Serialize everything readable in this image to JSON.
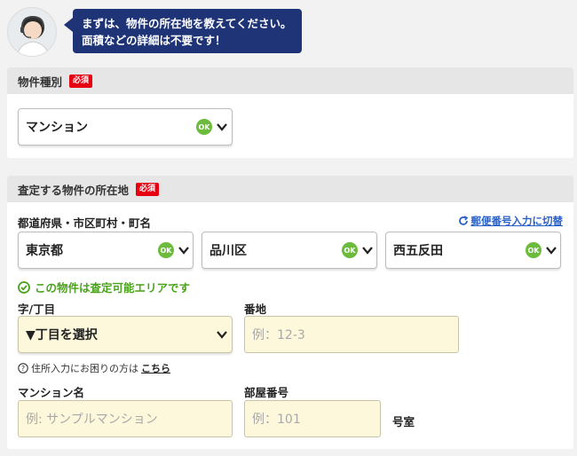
{
  "operator": {
    "message_line1": "まずは、物件の所在地を教えてください。",
    "message_line2": "面積などの詳細は不要です！"
  },
  "property_type": {
    "title": "物件種別",
    "required": "必須",
    "value": "マンション",
    "ok": "OK"
  },
  "location": {
    "title": "査定する物件の所在地",
    "required": "必須",
    "address_label": "都道府県・市区町村・町名",
    "postal_switch": "郵便番号入力に切替",
    "prefecture": "東京都",
    "city": "品川区",
    "town": "西五反田",
    "ok": "OK",
    "area_status": "この物件は査定可能エリアです",
    "chome_label": "字/丁目",
    "chome_select": "▼丁目を選択",
    "banchi_label": "番地",
    "banchi_placeholder": "例：12-3",
    "help_text": "住所入力にお困りの方は",
    "help_link": "こちら",
    "mansion_label": "マンション名",
    "mansion_placeholder": "例: サンプルマンション",
    "room_label": "部屋番号",
    "room_placeholder": "例：101",
    "room_suffix": "号室"
  },
  "colors": {
    "accent": "#1f3476",
    "required": "#e60012",
    "ok": "#6cbb3c",
    "link": "#2a62c9",
    "input_bg": "#fdf8dc"
  }
}
